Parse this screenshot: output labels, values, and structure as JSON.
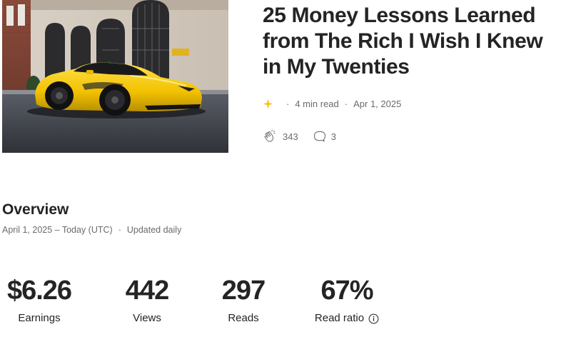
{
  "story": {
    "title": "25 Money Lessons Learned from The Rich I Wish I Knew in My Twenties",
    "thumbnail_icon": "yellow-sports-car-image",
    "meta": {
      "member_icon": "sparkle-star-icon",
      "read_time": "4 min read",
      "date": "Apr 1, 2025"
    },
    "engagement": {
      "claps_icon": "clap-icon",
      "claps": "343",
      "responses_icon": "comment-icon",
      "responses": "3"
    }
  },
  "overview": {
    "title": "Overview",
    "date_range": "April 1, 2025 – Today (UTC)",
    "update_note": "Updated daily"
  },
  "stats": [
    {
      "value": "$6.26",
      "label": "Earnings"
    },
    {
      "value": "442",
      "label": "Views"
    },
    {
      "value": "297",
      "label": "Reads"
    },
    {
      "value": "67%",
      "label": "Read ratio",
      "info_icon": "info-icon"
    }
  ],
  "colors": {
    "text_primary": "#242424",
    "text_secondary": "#6b6b6b",
    "accent_star": "#ffc017",
    "car_yellow": "#f5c400"
  }
}
